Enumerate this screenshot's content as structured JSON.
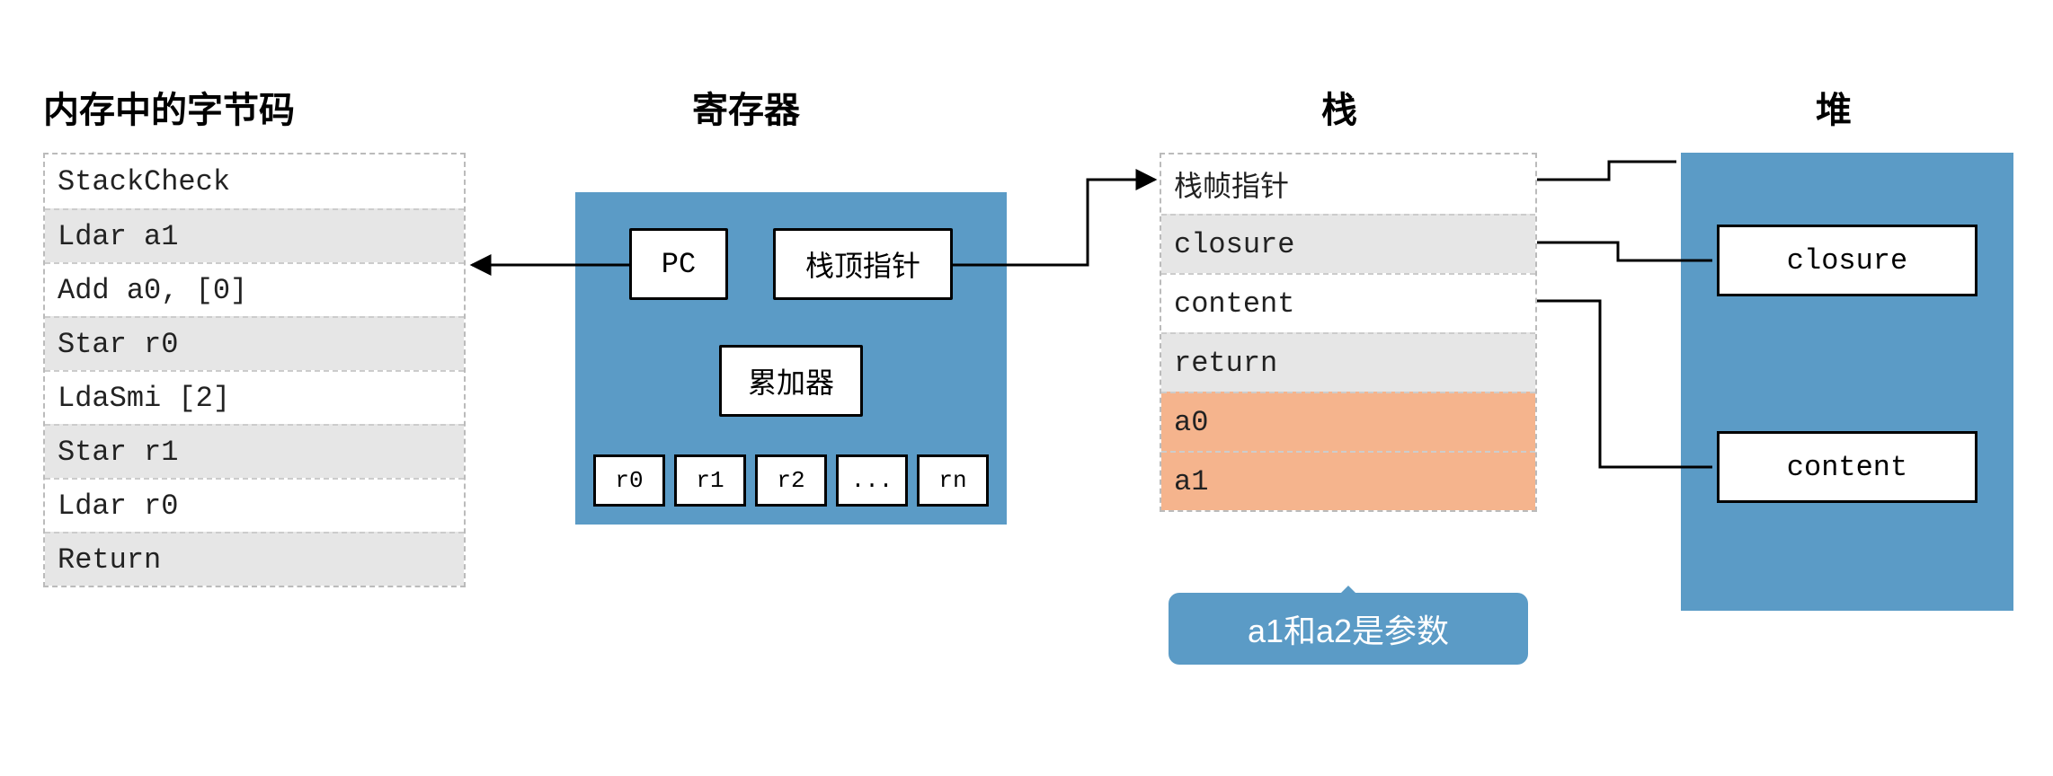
{
  "titles": {
    "bytecode": "内存中的字节码",
    "registers": "寄存器",
    "stack": "栈",
    "heap": "堆"
  },
  "bytecode": {
    "rows": [
      "StackCheck",
      "Ldar a1",
      "Add a0, [0]",
      "Star r0",
      "LdaSmi [2]",
      "Star r1",
      "Ldar r0",
      "Return"
    ]
  },
  "registers": {
    "pc": "PC",
    "sp": "栈顶指针",
    "accumulator": "累加器",
    "cells": [
      "r0",
      "r1",
      "r2",
      "...",
      "rn"
    ]
  },
  "stack": {
    "rows": [
      {
        "label": "栈帧指针",
        "style": "plain"
      },
      {
        "label": "closure",
        "style": "gray"
      },
      {
        "label": "content",
        "style": "plain"
      },
      {
        "label": "return",
        "style": "gray"
      },
      {
        "label": "a0",
        "style": "orange"
      },
      {
        "label": "a1",
        "style": "orange"
      }
    ],
    "callout": "a1和a2是参数"
  },
  "heap": {
    "cells": [
      "closure",
      "content"
    ]
  },
  "arrows": {
    "pc_to_bytecode": "PC → Ldar a1",
    "sp_to_stack_fp": "栈顶指针 → 栈帧指针",
    "stack_fp_to_heap_top": "栈帧指针 → 堆顶部",
    "stack_closure_to_heap_closure": "closure(栈) → closure(堆)",
    "stack_content_to_heap_content": "content(栈) → content(堆)"
  },
  "colors": {
    "panel_blue": "#5b9bc6",
    "row_gray": "#e6e6e6",
    "row_orange": "#f5b48d"
  }
}
